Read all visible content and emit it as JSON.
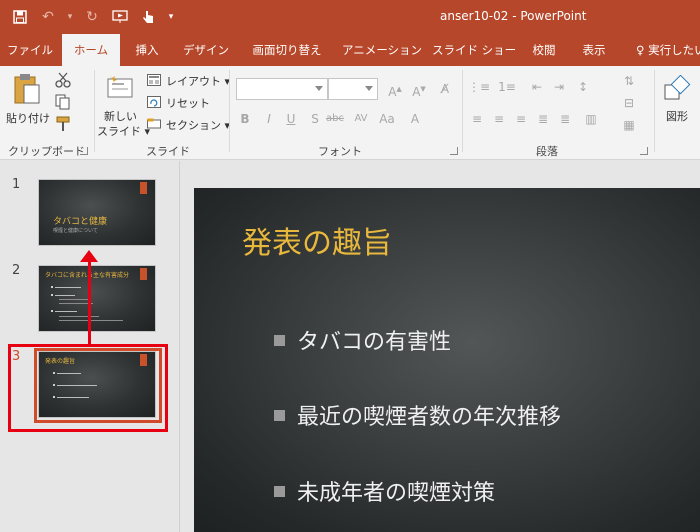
{
  "window": {
    "title": "anser10-02  -  PowerPoint"
  },
  "tabs": [
    {
      "label": "ファイル"
    },
    {
      "label": "ホーム"
    },
    {
      "label": "挿入"
    },
    {
      "label": "デザイン"
    },
    {
      "label": "画面切り替え"
    },
    {
      "label": "アニメーション"
    },
    {
      "label": "スライド ショー"
    },
    {
      "label": "校閲"
    },
    {
      "label": "表示"
    },
    {
      "label": "実行したい"
    }
  ],
  "ribbon": {
    "clipboard": {
      "paste_label": "貼り付け",
      "group_label": "クリップボード"
    },
    "slides": {
      "new_slide_line1": "新しい",
      "new_slide_line2": "スライド",
      "layout_label": "レイアウト",
      "reset_label": "リセット",
      "section_label": "セクション",
      "group_label": "スライド"
    },
    "font": {
      "font_name": "",
      "font_size": "",
      "group_label": "フォント"
    },
    "paragraph": {
      "group_label": "段落"
    },
    "drawing": {
      "shapes_label": "図形"
    }
  },
  "thumbnails": [
    {
      "number": "1",
      "title": "タバコと健康",
      "subtitle": "喫煙と健康について"
    },
    {
      "number": "2",
      "title": "タバコに含まれる主な有害成分"
    },
    {
      "number": "3",
      "title": "発表の趣旨"
    }
  ],
  "slide": {
    "title": "発表の趣旨",
    "bullets": [
      "タバコの有害性",
      "最近の喫煙者数の年次推移",
      "未成年者の喫煙対策"
    ]
  },
  "colors": {
    "accent": "#b7472a",
    "slide_title": "#e8b83c",
    "highlight": "#e60012"
  }
}
